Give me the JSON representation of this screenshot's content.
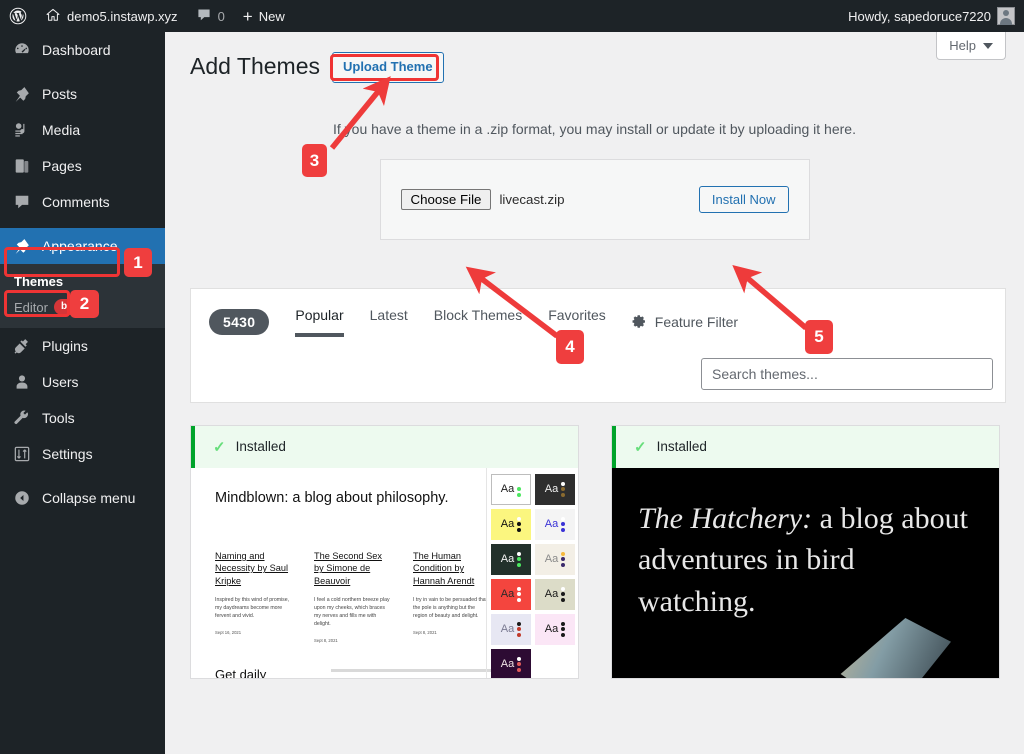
{
  "adminbar": {
    "logo_icon": "wordpress-logo-icon",
    "site_icon": "home-icon",
    "site_name": "demo5.instawp.xyz",
    "comments_icon": "comment-bubble-icon",
    "comments_count": "0",
    "new_icon": "plus-icon",
    "new_label": "New",
    "howdy": "Howdy, sapedoruce7220",
    "avatar_icon": "user-avatar-icon"
  },
  "sidebar": {
    "items": [
      {
        "label": "Dashboard",
        "icon": "dashboard-icon"
      },
      {
        "label": "Posts",
        "icon": "pin-icon"
      },
      {
        "label": "Media",
        "icon": "media-icon"
      },
      {
        "label": "Pages",
        "icon": "pages-icon"
      },
      {
        "label": "Comments",
        "icon": "comment-icon"
      },
      {
        "label": "Appearance",
        "icon": "appearance-brush-icon"
      },
      {
        "label": "Plugins",
        "icon": "plugins-plug-icon"
      },
      {
        "label": "Users",
        "icon": "users-icon"
      },
      {
        "label": "Tools",
        "icon": "tools-wrench-icon"
      },
      {
        "label": "Settings",
        "icon": "settings-sliders-icon"
      },
      {
        "label": "Collapse menu",
        "icon": "collapse-arrow-icon"
      }
    ],
    "submenu": {
      "themes": "Themes",
      "editor": "Editor",
      "editor_badge": "beta"
    }
  },
  "help": {
    "label": "Help",
    "icon": "chevron-down-icon"
  },
  "page": {
    "title": "Add Themes",
    "upload_theme_button": "Upload Theme",
    "upload_note": "If you have a theme in a .zip format, you may install or update it by uploading it here."
  },
  "upload": {
    "choose_file_button": "Choose File",
    "file_name": "livecast.zip",
    "install_button": "Install Now"
  },
  "filters": {
    "count": "5430",
    "tabs": [
      {
        "label": "Popular",
        "active": true
      },
      {
        "label": "Latest",
        "active": false
      },
      {
        "label": "Block Themes",
        "active": false
      },
      {
        "label": "Favorites",
        "active": false
      }
    ],
    "feature_filter": "Feature Filter",
    "feature_filter_icon": "gear-icon",
    "search_placeholder": "Search themes..."
  },
  "themes": [
    {
      "status": "Installed",
      "status_icon": "check-icon",
      "preview": {
        "heading": "Mindblown: a blog about philosophy.",
        "posts": [
          {
            "title": "Naming and Necessity by Saul Kripke",
            "excerpt": "Inspired by this wind of promise, my daydreams become more fervent and vivid.",
            "date": "Sept 16, 2021"
          },
          {
            "title": "The Second Sex by Simone de Beauvoir",
            "excerpt": "I feel a cold northern breeze play upon my cheeks, which braces my nerves and fills me with delight.",
            "date": "Sept 8, 2021"
          },
          {
            "title": "The Human Condition by Hannah Arendt",
            "excerpt": "I try in vain to be persuaded that the pole is anything but the region of beauty and delight.",
            "date": "Sept 8, 2021"
          }
        ],
        "footer_heading": "Get daily",
        "swatch_label": "Aa",
        "swatches": [
          {
            "bg": "#ffffff",
            "fg": "#1a1a1a",
            "dot1": "#ffffff",
            "dot2": "#4ce660",
            "border": "#bdbdbd"
          },
          {
            "bg": "#2e2e2e",
            "fg": "#f0f0f0",
            "dot1": "#ffffff",
            "dot2": "#8a6a2f",
            "border": "#2e2e2e"
          },
          {
            "bg": "#fbf67f",
            "fg": "#101010",
            "dot1": "#ffffff",
            "dot2": "#101010",
            "border": "#fbf67f"
          },
          {
            "bg": "#f4f4f4",
            "fg": "#3a32d6",
            "dot1": "#ffffff",
            "dot2": "#3a32d6",
            "border": "#f4f4f4"
          },
          {
            "bg": "#22312b",
            "fg": "#f5f5f5",
            "dot1": "#ffffff",
            "dot2": "#4ce660",
            "border": "#22312b"
          },
          {
            "bg": "#f3efe6",
            "fg": "#8a8a8a",
            "dot1": "#f5b83d",
            "dot2": "#3b2a6b",
            "border": "#f3efe6"
          },
          {
            "bg": "#f4453e",
            "fg": "#2a2a2a",
            "dot1": "#ffffff",
            "dot2": "#ffffff",
            "border": "#f4453e"
          },
          {
            "bg": "#dcdcc8",
            "fg": "#1a1a1a",
            "dot1": "#ffffff",
            "dot2": "#1a1a1a",
            "border": "#dcdcc8"
          },
          {
            "bg": "#e7e7f3",
            "fg": "#7a7a92",
            "dot1": "#1a1a1a",
            "dot2": "#c0392b",
            "border": "#e7e7f3"
          },
          {
            "bg": "#fbe6f6",
            "fg": "#1a1a1a",
            "dot1": "#1a1a1a",
            "dot2": "#1a1a1a",
            "border": "#fbe6f6"
          },
          {
            "bg": "#2d0b33",
            "fg": "#f0e6e6",
            "dot1": "#ffffff",
            "dot2": "#e05a5a",
            "border": "#2d0b33"
          }
        ]
      }
    },
    {
      "status": "Installed",
      "status_icon": "check-icon",
      "preview": {
        "heading_italic": "The Hatchery:",
        "heading_rest": " a blog about adventures in bird watching.",
        "image_icon": "bird-wing-image"
      }
    }
  ],
  "annotations": [
    {
      "number": "1",
      "target": "appearance-menu"
    },
    {
      "number": "2",
      "target": "themes-submenu"
    },
    {
      "number": "3",
      "target": "upload-theme-button"
    },
    {
      "number": "4",
      "target": "choose-file-button"
    },
    {
      "number": "5",
      "target": "install-now-button"
    }
  ],
  "colors": {
    "accent_blue": "#2271b1",
    "annotation_red": "#ef3434",
    "installed_green": "#00a32a",
    "admin_dark": "#1d2327"
  }
}
